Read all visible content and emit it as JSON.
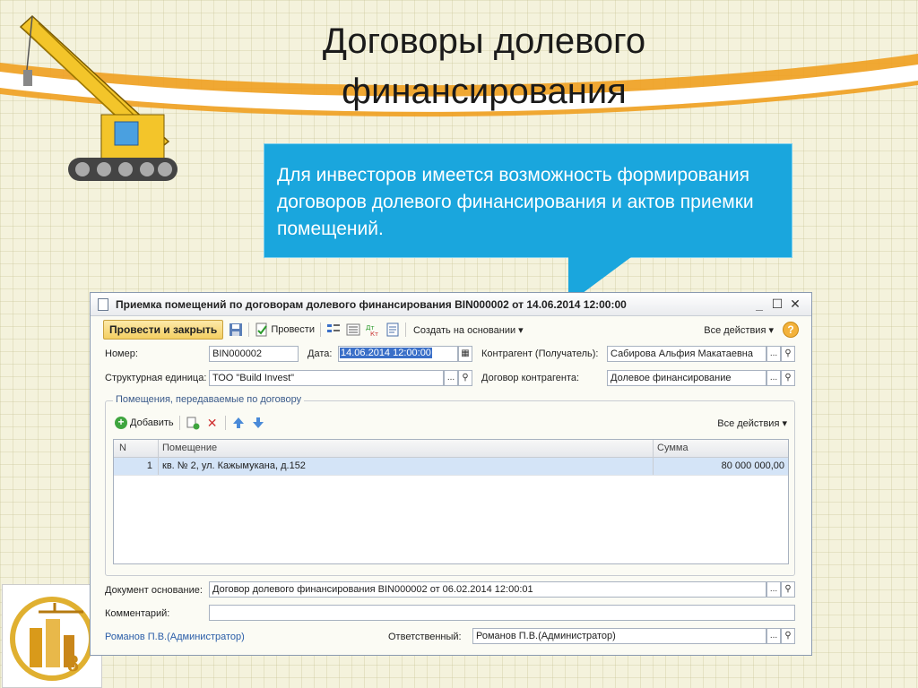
{
  "slide": {
    "title": "Договоры долевого финансирования",
    "callout": "Для инвесторов имеется возможность формирования договоров долевого финансирования и актов приемки помещений."
  },
  "window": {
    "title": "Приемка помещений по договорам долевого финансирования BIN000002 от 14.06.2014 12:00:00",
    "min_glyph": "_",
    "max_glyph": "☐",
    "close_glyph": "✕"
  },
  "toolbar": {
    "post_close_label": "Провести и закрыть",
    "post_label": "Провести",
    "create_based_label": "Создать на основании ▾",
    "all_actions_label": "Все действия ▾",
    "help_label": "?"
  },
  "form": {
    "number_label": "Номер:",
    "number_value": "BIN000002",
    "date_label": "Дата:",
    "date_value": "14.06.2014 12:00:00",
    "counterparty_label": "Контрагент (Получатель):",
    "counterparty_value": "Сабирова Альфия Макатаевна",
    "unit_label": "Структурная единица:",
    "unit_value": "ТОО \"Build Invest\"",
    "contract_label": "Договор контрагента:",
    "contract_value": "Долевое финансирование",
    "basis_label": "Документ основание:",
    "basis_value": "Договор долевого финансирования BIN000002 от 06.02.2014 12:00:01",
    "comment_label": "Комментарий:",
    "comment_value": "",
    "author_link": "Романов П.В.(Администратор)",
    "responsible_label": "Ответственный:",
    "responsible_value": "Романов П.В.(Администратор)",
    "select_glyph": "...",
    "search_glyph": "🔍"
  },
  "rooms_group": {
    "title": "Помещения, передаваемые по договору",
    "add_label": "Добавить",
    "all_actions_label": "Все действия ▾",
    "columns": {
      "n": "N",
      "room": "Помещение",
      "sum": "Сумма"
    },
    "rows": [
      {
        "n": "1",
        "room": "кв. № 2, ул. Кажымукана, д.152",
        "sum": "80 000 000,00"
      }
    ]
  },
  "colors": {
    "callout_bg": "#1aa6dd",
    "primary_button": "#f4cf62",
    "selected_row": "#d4e4f7",
    "link": "#2b5ea8"
  }
}
